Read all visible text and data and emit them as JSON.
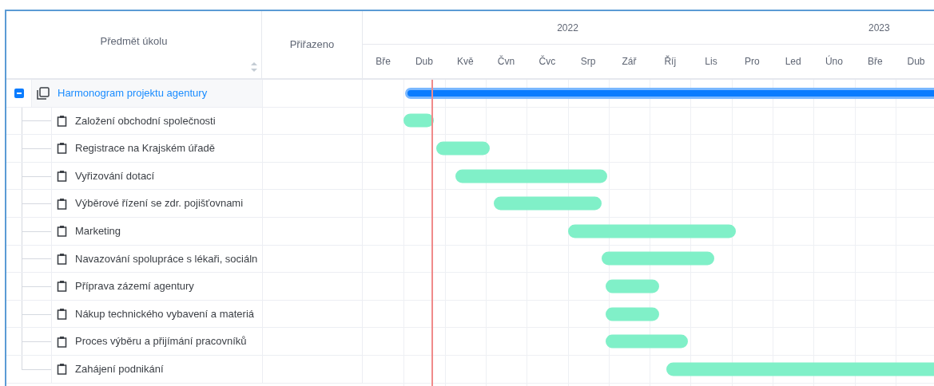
{
  "columns": [
    {
      "label": "Předmět úkolu",
      "sortable": true
    },
    {
      "label": "Přiřazeno",
      "sortable": false
    }
  ],
  "tasks": [
    {
      "name": "Harmonogram projektu agentury",
      "kind": "project",
      "expanded": true,
      "children": [
        {
          "name": "Založení obchodní společnosti",
          "kind": "task"
        },
        {
          "name": "Registrace na Krajském úřadě",
          "kind": "task"
        },
        {
          "name": "Vyřizování dotací",
          "kind": "task"
        },
        {
          "name": "Výběrové řízení se zdr. pojišťovnami",
          "kind": "task"
        },
        {
          "name": "Marketing",
          "kind": "task"
        },
        {
          "name": "Navazování spolupráce s lékaři, sociáln",
          "kind": "task"
        },
        {
          "name": "Příprava zázemí agentury",
          "kind": "task"
        },
        {
          "name": "Nákup technického vybavení a materiá",
          "kind": "task"
        },
        {
          "name": "Proces výběru a přijímání pracovníků",
          "kind": "task"
        },
        {
          "name": "Zahájení podnikání",
          "kind": "task"
        }
      ]
    }
  ],
  "timeline": {
    "years": [
      {
        "label": "2022",
        "months": [
          "Bře",
          "Dub",
          "Kvě",
          "Čvn",
          "Čvc",
          "Srp",
          "Zář",
          "Říj",
          "Lis",
          "Pro"
        ]
      },
      {
        "label": "2023",
        "months": [
          "Led",
          "Úno",
          "Bře",
          "Dub"
        ]
      }
    ]
  }
}
